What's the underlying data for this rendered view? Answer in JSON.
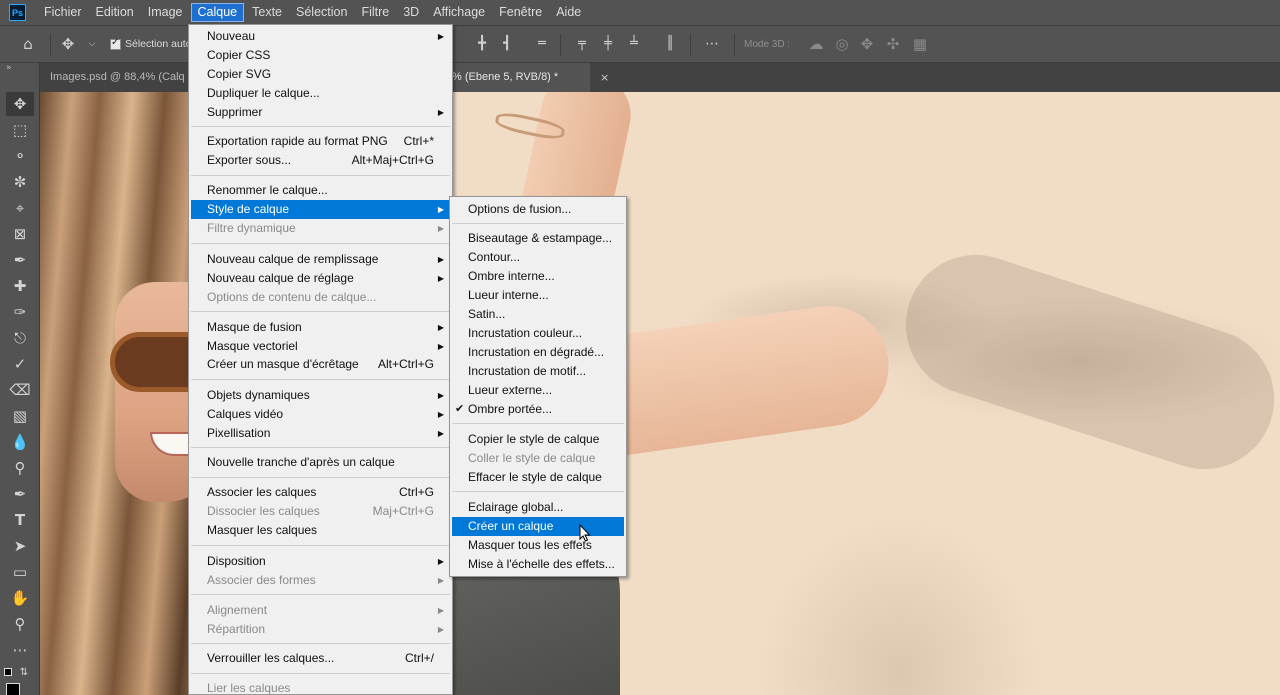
{
  "app": {
    "logo": "Ps"
  },
  "menubar": {
    "items": [
      "Fichier",
      "Edition",
      "Image",
      "Calque",
      "Texte",
      "Sélection",
      "Filtre",
      "3D",
      "Affichage",
      "Fenêtre",
      "Aide"
    ],
    "active": "Calque"
  },
  "options": {
    "auto_select_label": "Sélection auto",
    "mode3d_label": "Mode 3D :"
  },
  "tabs": {
    "tab1": "Images.psd @ 88,4% (Calq",
    "tab2": "% (Ebene 5, RVB/8) *",
    "close": "×"
  },
  "layer_menu": {
    "nouveau": "Nouveau",
    "copier_css": "Copier CSS",
    "copier_svg": "Copier SVG",
    "dupliquer": "Dupliquer le calque...",
    "supprimer": "Supprimer",
    "export_png": "Exportation rapide au format PNG",
    "export_png_sc": "Ctrl+*",
    "exporter_sous": "Exporter sous...",
    "exporter_sous_sc": "Alt+Maj+Ctrl+G",
    "renommer": "Renommer le calque...",
    "style": "Style de calque",
    "filtre_dyn": "Filtre dynamique",
    "remplissage": "Nouveau calque de remplissage",
    "reglage": "Nouveau calque de réglage",
    "options_contenu": "Options de contenu de calque...",
    "masque_fusion": "Masque de fusion",
    "masque_vect": "Masque vectoriel",
    "masque_ecretage": "Créer un masque d'écrêtage",
    "masque_ecretage_sc": "Alt+Ctrl+G",
    "objets_dyn": "Objets dynamiques",
    "calques_video": "Calques vidéo",
    "pixellisation": "Pixellisation",
    "tranche": "Nouvelle tranche d'après un calque",
    "associer": "Associer les calques",
    "associer_sc": "Ctrl+G",
    "dissocier": "Dissocier les calques",
    "dissocier_sc": "Maj+Ctrl+G",
    "masquer": "Masquer les calques",
    "disposition": "Disposition",
    "associer_formes": "Associer des formes",
    "alignement": "Alignement",
    "repartition": "Répartition",
    "verrouiller": "Verrouiller les calques...",
    "verrouiller_sc": "Ctrl+/",
    "lier": "Lier les calques"
  },
  "style_submenu": {
    "options_fusion": "Options de fusion...",
    "biseautage": "Biseautage & estampage...",
    "contour": "Contour...",
    "ombre_interne": "Ombre interne...",
    "lueur_interne": "Lueur interne...",
    "satin": "Satin...",
    "incrust_couleur": "Incrustation couleur...",
    "incrust_degrade": "Incrustation en dégradé...",
    "incrust_motif": "Incrustation de motif...",
    "lueur_externe": "Lueur externe...",
    "ombre_portee": "Ombre portée...",
    "copier_style": "Copier le style de calque",
    "coller_style": "Coller le style de calque",
    "effacer_style": "Effacer le style de calque",
    "eclairage": "Eclairage global...",
    "creer_calque": "Créer un calque",
    "masquer_effets": "Masquer tous les effets",
    "mise_echelle": "Mise à l'échelle des effets..."
  },
  "colors": {
    "highlight": "#0078d7",
    "menu_bg": "#f0f0f0",
    "ui_bg": "#535353"
  }
}
